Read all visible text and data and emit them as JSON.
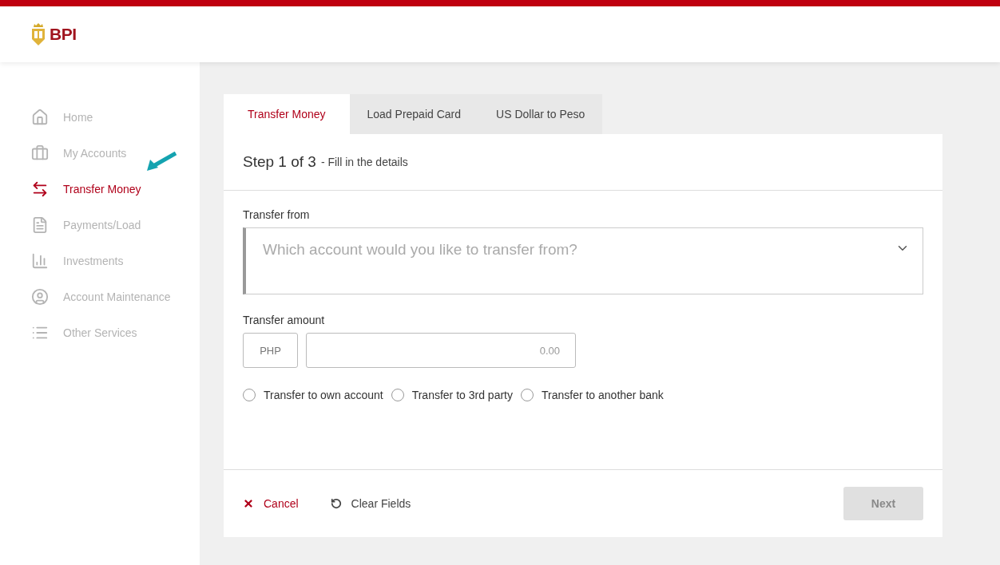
{
  "header": {
    "logo": "BPI"
  },
  "sidebar": {
    "items": [
      {
        "label": "Home",
        "selected": false
      },
      {
        "label": "My Accounts",
        "selected": false
      },
      {
        "label": "Transfer Money",
        "selected": true
      },
      {
        "label": "Payments/Load",
        "selected": false
      },
      {
        "label": "Investments",
        "selected": false
      },
      {
        "label": "Account Maintenance",
        "selected": false
      },
      {
        "label": "Other Services",
        "selected": false
      }
    ]
  },
  "tabs": [
    {
      "label": "Transfer Money",
      "selected": true
    },
    {
      "label": "Load Prepaid Card",
      "selected": false
    },
    {
      "label": "US Dollar to Peso",
      "selected": false
    }
  ],
  "step": {
    "title": "Step 1 of 3",
    "subtitle": "- Fill in the details"
  },
  "transfer_from": {
    "label": "Transfer from",
    "placeholder": "Which account would you like to transfer from?"
  },
  "transfer_amount": {
    "label": "Transfer amount",
    "currency": "PHP",
    "placeholder": "0.00"
  },
  "transfer_types": [
    {
      "label": "Transfer to own account",
      "selected": false
    },
    {
      "label": "Transfer to 3rd party",
      "selected": false
    },
    {
      "label": "Transfer to another bank",
      "selected": false
    }
  ],
  "actions": {
    "cancel": "Cancel",
    "clear": "Clear Fields",
    "next": {
      "label": "Next",
      "disabled": true
    }
  }
}
